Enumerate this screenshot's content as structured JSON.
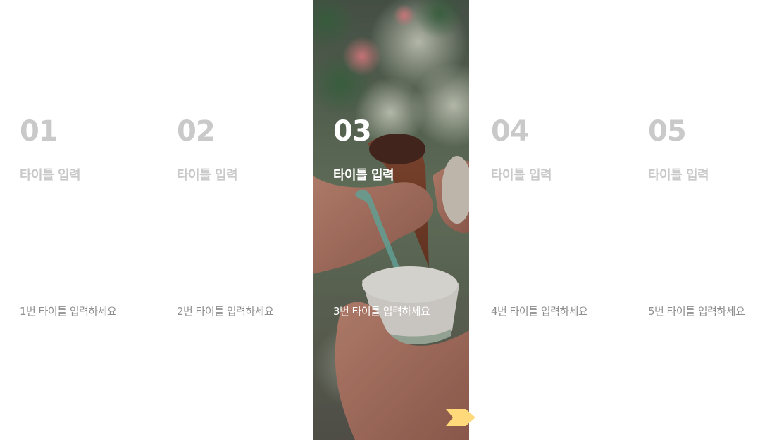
{
  "slides": [
    {
      "number": "01",
      "title": "타이틀 입력",
      "description": "1번 타이틀 입력하세요"
    },
    {
      "number": "02",
      "title": "타이틀 입력",
      "description": "2번 타이틀 입력하세요"
    },
    {
      "number": "03",
      "title": "타이틀 입력",
      "description": "3번 타이틀 입력하세요"
    },
    {
      "number": "04",
      "title": "타이틀 입력",
      "description": "4번 타이틀 입력하세요"
    },
    {
      "number": "05",
      "title": "타이틀 입력",
      "description": "5번 타이틀 입력하세요"
    }
  ],
  "active_index": 2,
  "colors": {
    "inactive_text": "#c9c9c9",
    "inactive_desc": "#8e8e8e",
    "active_text": "#ffffff",
    "arrow": "#ffd97a"
  },
  "icons": {
    "next": "chevron-right-icon",
    "photo": "ice-cream-photo"
  }
}
